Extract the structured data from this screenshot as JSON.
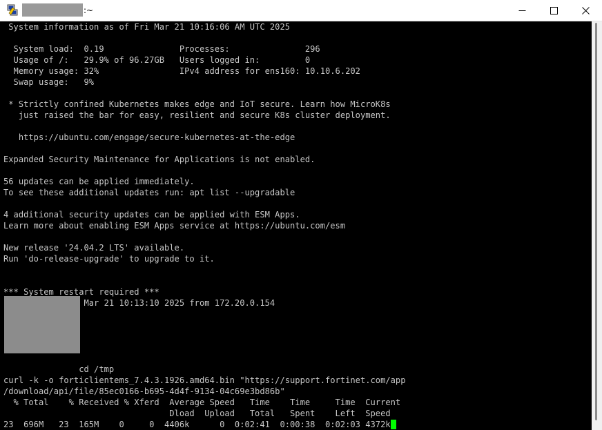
{
  "window": {
    "title_suffix": ":~",
    "icon": "putty-icon",
    "controls": {
      "minimize": "minimize-icon",
      "maximize": "maximize-icon",
      "close": "close-icon"
    }
  },
  "terminal": {
    "lines": [
      " System information as of Fri Mar 21 10:16:06 AM UTC 2025",
      "",
      "  System load:  0.19               Processes:               296",
      "  Usage of /:   29.9% of 96.27GB   Users logged in:         0",
      "  Memory usage: 32%                IPv4 address for ens160: 10.10.6.202",
      "  Swap usage:   9%",
      "",
      " * Strictly confined Kubernetes makes edge and IoT secure. Learn how MicroK8s",
      "   just raised the bar for easy, resilient and secure K8s cluster deployment.",
      "",
      "   https://ubuntu.com/engage/secure-kubernetes-at-the-edge",
      "",
      "Expanded Security Maintenance for Applications is not enabled.",
      "",
      "56 updates can be applied immediately.",
      "To see these additional updates run: apt list --upgradable",
      "",
      "4 additional security updates can be applied with ESM Apps.",
      "Learn more about enabling ESM Apps service at https://ubuntu.com/esm",
      "",
      "New release '24.04.2 LTS' available.",
      "Run 'do-release-upgrade' to upgrade to it.",
      "",
      "",
      "*** System restart required ***",
      "Last login: Fri Mar 21 10:13:10 2025 from 172.20.0.154",
      "",
      "",
      "",
      "",
      "",
      "               cd /tmp",
      "curl -k -o forticlientems_7.4.3.1926.amd64.bin \"https://support.fortinet.com/app",
      "/download/api/file/85ec0166-b695-4d4f-9134-04c69e3bd86b\"",
      "  % Total    % Received % Xferd  Average Speed   Time    Time     Time  Current",
      "                                 Dload  Upload   Total   Spent    Left  Speed",
      "23  696M   23  165M    0     0  4406k      0  0:02:41  0:00:38  0:02:03 4372k"
    ]
  }
}
